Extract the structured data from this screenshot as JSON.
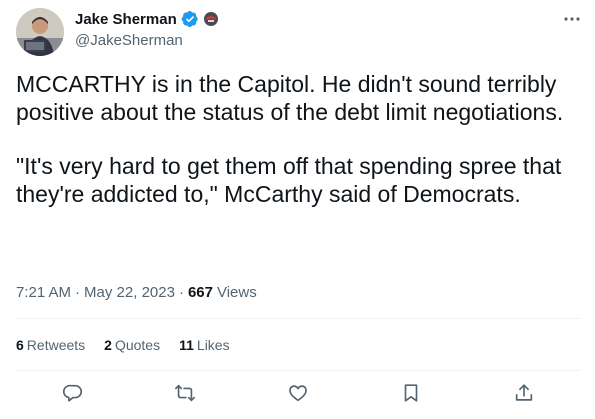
{
  "author": {
    "name": "Jake Sherman",
    "handle": "@JakeSherman"
  },
  "tweet": {
    "paragraphs": [
      "MCCARTHY is in the Capitol. He didn't sound terribly positive about the status of the debt limit negotiations.",
      "\"It's very hard to get them off that spending spree that they're addicted to,\" McCarthy said of Democrats."
    ],
    "time": "7:21 AM",
    "separator": "·",
    "date": "May 22, 2023",
    "views_count": "667",
    "views_label": "Views"
  },
  "stats": {
    "retweets_count": "6",
    "retweets_label": "Retweets",
    "quotes_count": "2",
    "quotes_label": "Quotes",
    "likes_count": "11",
    "likes_label": "Likes"
  },
  "icons": {
    "verified": "verified-badge-icon",
    "affiliation": "affiliation-badge-icon",
    "more": "more-options-icon",
    "reply": "reply-icon",
    "retweet": "retweet-icon",
    "like": "heart-icon",
    "bookmark": "bookmark-icon",
    "share": "share-icon"
  },
  "colors": {
    "verified_blue": "#1d9bf0",
    "text_primary": "#0f1419",
    "text_secondary": "#536471",
    "divider": "#eff3f4"
  }
}
